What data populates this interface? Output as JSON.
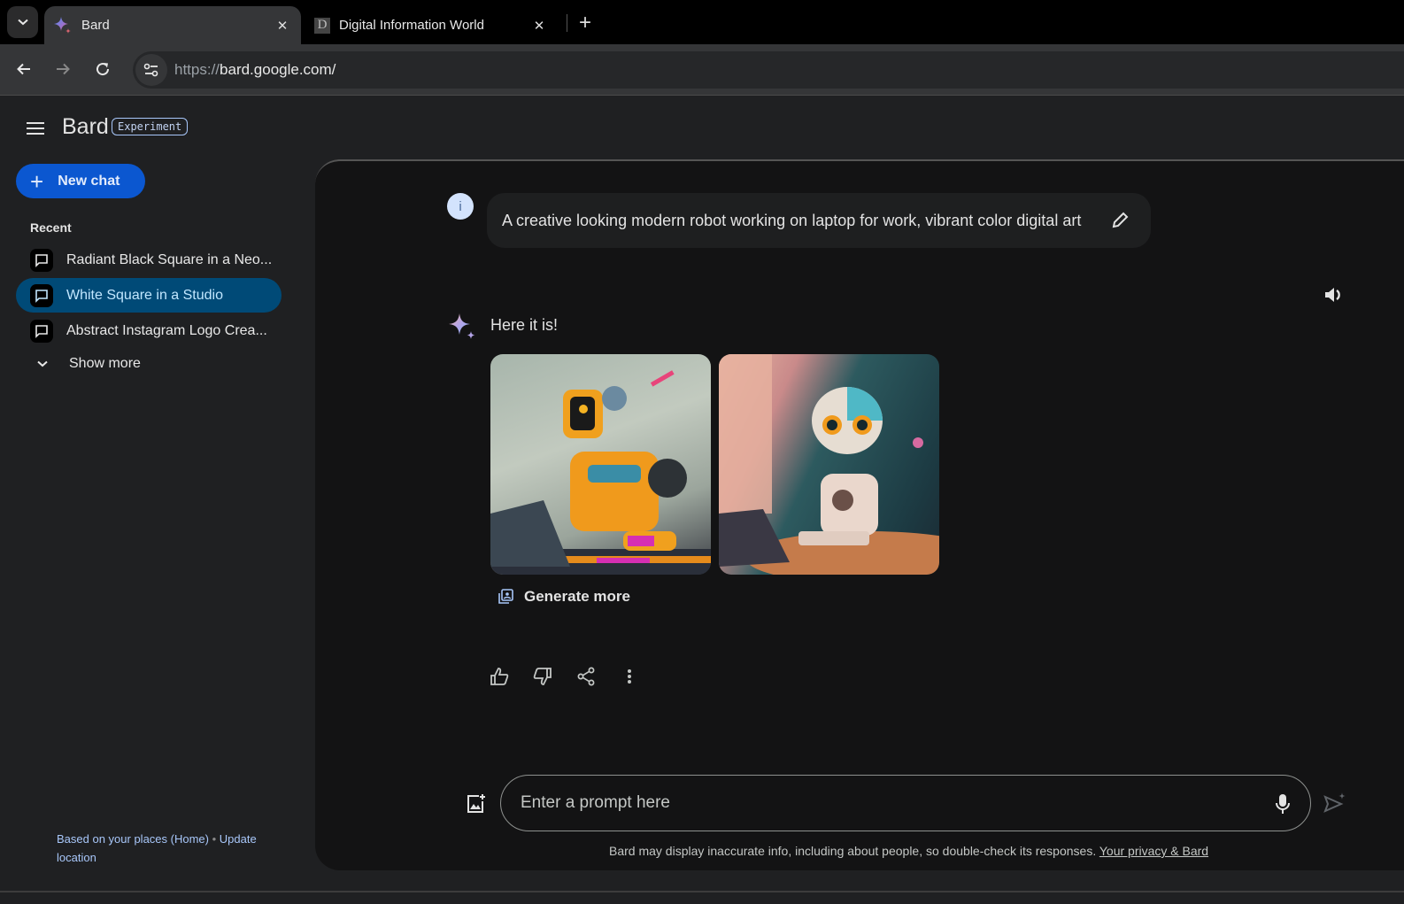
{
  "browser": {
    "tabs": [
      {
        "title": "Bard",
        "favicon": "bard-sparkle-icon",
        "active": true
      },
      {
        "title": "Digital Information World",
        "favicon": "D",
        "active": false
      }
    ],
    "url_scheme": "https://",
    "url_host": "bard.google.com/"
  },
  "sidebar": {
    "brand": "Bard",
    "badge": "Experiment",
    "new_chat_label": "New chat",
    "recent_label": "Recent",
    "recent_items": [
      {
        "label": "Radiant Black Square in a Neo...",
        "active": false
      },
      {
        "label": "White Square in a Studio",
        "active": true
      },
      {
        "label": "Abstract Instagram Logo Crea...",
        "active": false
      }
    ],
    "show_more_label": "Show more",
    "location_text": "Based on your places (Home)",
    "location_separator": "•",
    "update_location_label": "Update location"
  },
  "conversation": {
    "user_avatar_letter": "i",
    "user_prompt": "A creative looking modern robot working on laptop for work, vibrant color digital art",
    "response_text": "Here it is!",
    "images": [
      {
        "alt": "Orange robot working on laptop"
      },
      {
        "alt": "Teal and white robot typing at laptop by window"
      }
    ],
    "generate_more_label": "Generate more"
  },
  "input": {
    "placeholder": "Enter a prompt here",
    "value": ""
  },
  "footer": {
    "disclaimer": "Bard may display inaccurate info, including about people, so double-check its responses.",
    "privacy_link": "Your privacy & Bard"
  },
  "colors": {
    "accent": "#0b57d0",
    "active_item_bg": "#004a77",
    "active_item_text": "#c2e7ff",
    "link": "#a8c7fa",
    "main_bg": "#131314",
    "sidebar_bg": "#1f2022"
  }
}
